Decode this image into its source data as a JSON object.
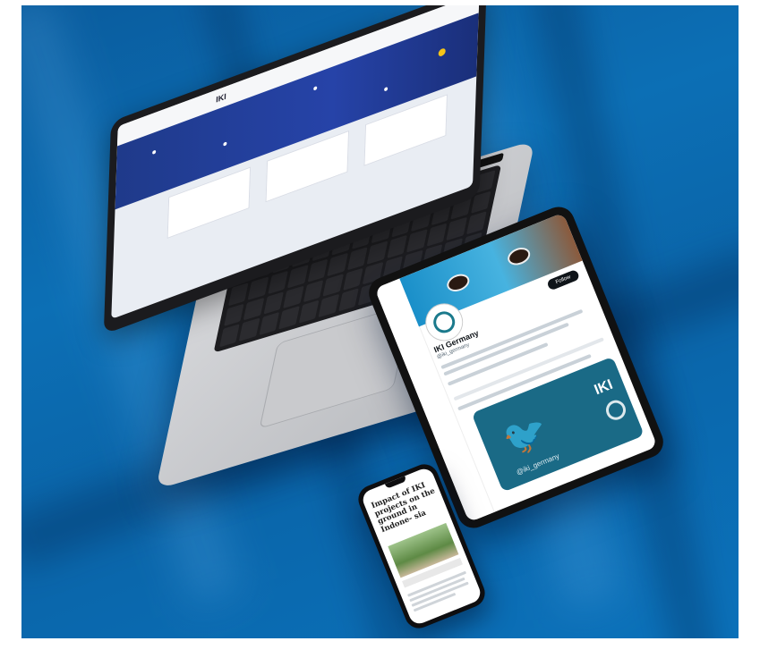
{
  "scene": {
    "background_color": "#0b6cb2",
    "description_tag": "device-mockup"
  },
  "laptop": {
    "site_logo_text": "IKI",
    "screen_primary_color": "#2643a8"
  },
  "tablet": {
    "profile_name": "IKI Germany",
    "profile_handle": "@iki_germany",
    "follow_label": "Follow",
    "card_logo_text": "IKI",
    "card_handle": "@iki_germany",
    "card_color": "#1a6a86"
  },
  "phone": {
    "headline": "Impact of IKI projects on the ground in Indonesia",
    "headline_visible": "Impact of IKI projects on the ground in Indone- sia"
  }
}
